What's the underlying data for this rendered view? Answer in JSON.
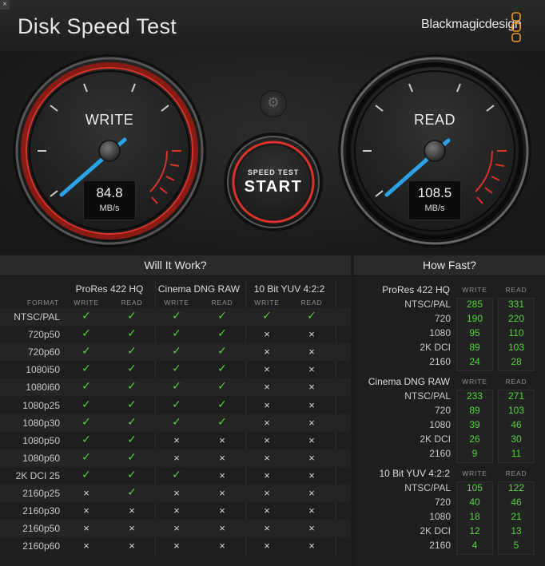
{
  "window": {
    "close_glyph": "×"
  },
  "app": {
    "title": "Disk Speed Test",
    "brand": "Blackmagicdesign"
  },
  "gauges": {
    "write": {
      "label": "WRITE",
      "value": "84.8",
      "unit": "MB/s"
    },
    "read": {
      "label": "READ",
      "value": "108.5",
      "unit": "MB/s"
    }
  },
  "start_button": {
    "top_label": "SPEED TEST",
    "main_label": "START"
  },
  "settings": {
    "icon": "gear-icon",
    "glyph": "⚙"
  },
  "will_it_work": {
    "title": "Will It Work?",
    "format_header": "FORMAT",
    "codecs": [
      "ProRes 422 HQ",
      "Cinema DNG RAW",
      "10 Bit YUV 4:2:2"
    ],
    "sub_headers": [
      "WRITE",
      "READ"
    ],
    "rows": [
      {
        "format": "NTSC/PAL",
        "marks": [
          true,
          true,
          true,
          true,
          true,
          true
        ]
      },
      {
        "format": "720p50",
        "marks": [
          true,
          true,
          true,
          true,
          false,
          false
        ]
      },
      {
        "format": "720p60",
        "marks": [
          true,
          true,
          true,
          true,
          false,
          false
        ]
      },
      {
        "format": "1080i50",
        "marks": [
          true,
          true,
          true,
          true,
          false,
          false
        ]
      },
      {
        "format": "1080i60",
        "marks": [
          true,
          true,
          true,
          true,
          false,
          false
        ]
      },
      {
        "format": "1080p25",
        "marks": [
          true,
          true,
          true,
          true,
          false,
          false
        ]
      },
      {
        "format": "1080p30",
        "marks": [
          true,
          true,
          true,
          true,
          false,
          false
        ]
      },
      {
        "format": "1080p50",
        "marks": [
          true,
          true,
          false,
          false,
          false,
          false
        ]
      },
      {
        "format": "1080p60",
        "marks": [
          true,
          true,
          false,
          false,
          false,
          false
        ]
      },
      {
        "format": "2K DCI 25",
        "marks": [
          true,
          true,
          true,
          false,
          false,
          false
        ]
      },
      {
        "format": "2160p25",
        "marks": [
          false,
          true,
          false,
          false,
          false,
          false
        ]
      },
      {
        "format": "2160p30",
        "marks": [
          false,
          false,
          false,
          false,
          false,
          false
        ]
      },
      {
        "format": "2160p50",
        "marks": [
          false,
          false,
          false,
          false,
          false,
          false
        ]
      },
      {
        "format": "2160p60",
        "marks": [
          false,
          false,
          false,
          false,
          false,
          false
        ]
      }
    ],
    "check_glyph": "✓",
    "cross_glyph": "×"
  },
  "how_fast": {
    "title": "How Fast?",
    "sub_headers": [
      "WRITE",
      "READ"
    ],
    "groups": [
      {
        "codec": "ProRes 422 HQ",
        "rows": [
          {
            "format": "NTSC/PAL",
            "write": "285",
            "read": "331"
          },
          {
            "format": "720",
            "write": "190",
            "read": "220"
          },
          {
            "format": "1080",
            "write": "95",
            "read": "110"
          },
          {
            "format": "2K DCI",
            "write": "89",
            "read": "103"
          },
          {
            "format": "2160",
            "write": "24",
            "read": "28"
          }
        ]
      },
      {
        "codec": "Cinema DNG RAW",
        "rows": [
          {
            "format": "NTSC/PAL",
            "write": "233",
            "read": "271"
          },
          {
            "format": "720",
            "write": "89",
            "read": "103"
          },
          {
            "format": "1080",
            "write": "39",
            "read": "46"
          },
          {
            "format": "2K DCI",
            "write": "26",
            "read": "30"
          },
          {
            "format": "2160",
            "write": "9",
            "read": "11"
          }
        ]
      },
      {
        "codec": "10 Bit YUV 4:2:2",
        "rows": [
          {
            "format": "NTSC/PAL",
            "write": "105",
            "read": "122"
          },
          {
            "format": "720",
            "write": "40",
            "read": "46"
          },
          {
            "format": "1080",
            "write": "18",
            "read": "21"
          },
          {
            "format": "2K DCI",
            "write": "12",
            "read": "13"
          },
          {
            "format": "2160",
            "write": "4",
            "read": "5"
          }
        ]
      }
    ]
  },
  "colors": {
    "accent_red": "#d8332a",
    "needle_blue": "#2aa3e6",
    "ok_green": "#52d43a"
  }
}
